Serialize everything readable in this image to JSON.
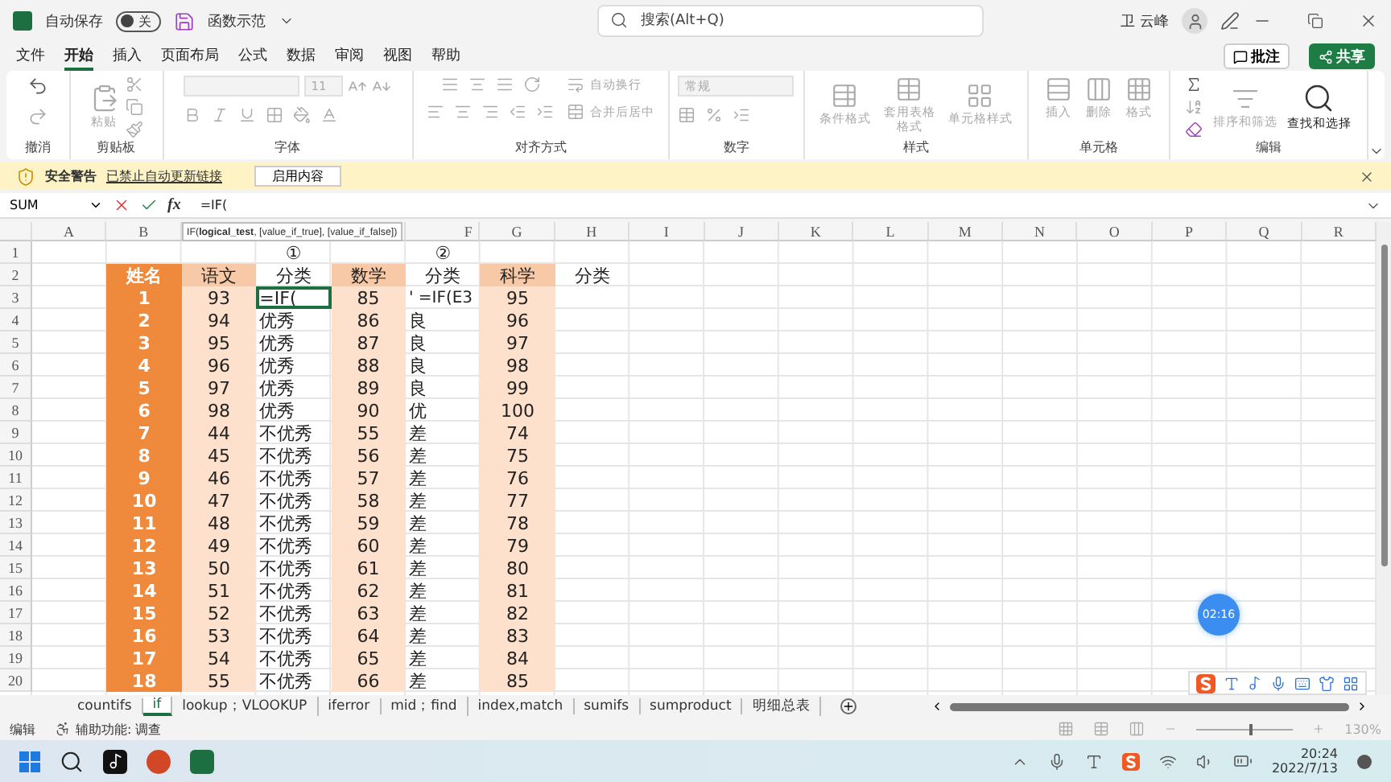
{
  "titlebar": {
    "autosave_label": "自动保存",
    "autosave": {
      "on": false,
      "label": "关"
    },
    "file_name": "函数示范",
    "search": {
      "placeholder": "搜索(Alt+Q)"
    },
    "user": "卫 云峰"
  },
  "menu": {
    "tabs": [
      {
        "label": "文件",
        "selected": false
      },
      {
        "label": "开始",
        "selected": true
      },
      {
        "label": "插入",
        "selected": false
      },
      {
        "label": "页面布局",
        "selected": false
      },
      {
        "label": "公式",
        "selected": false
      },
      {
        "label": "数据",
        "selected": false
      },
      {
        "label": "审阅",
        "selected": false
      },
      {
        "label": "视图",
        "selected": false
      },
      {
        "label": "帮助",
        "selected": false
      }
    ],
    "comment_button": "批注",
    "share_button": "共享"
  },
  "ribbon": {
    "groups": [
      {
        "kind": "undo",
        "label": "撤消"
      },
      {
        "kind": "clipboard",
        "label": "剪贴板",
        "buttons": [
          {
            "label": "粘贴",
            "disabled": true
          }
        ]
      },
      {
        "kind": "font",
        "label": "字体",
        "font_size": "11"
      },
      {
        "kind": "alignment",
        "label": "对齐方式",
        "buttons": [
          {
            "label": "自动换行",
            "disabled": true
          },
          {
            "label": "合并后居中",
            "disabled": true
          }
        ]
      },
      {
        "kind": "number",
        "label": "数字",
        "format": "常规"
      },
      {
        "kind": "styles",
        "label": "样式",
        "buttons": [
          {
            "label": "条件格式",
            "disabled": true
          },
          {
            "label": "套用表格格式",
            "disabled": true
          },
          {
            "label": "单元格样式",
            "disabled": true
          }
        ]
      },
      {
        "kind": "cells",
        "label": "单元格",
        "buttons": [
          {
            "label": "插入",
            "disabled": true
          },
          {
            "label": "删除",
            "disabled": true
          },
          {
            "label": "格式",
            "disabled": true
          }
        ]
      },
      {
        "kind": "editing",
        "label": "编辑",
        "buttons": [
          {
            "label": "排序和筛选",
            "disabled": true
          },
          {
            "label": "查找和选择",
            "disabled": false
          }
        ]
      }
    ]
  },
  "warning": {
    "title": "安全警告",
    "link": "已禁止自动更新链接",
    "button": "启用内容"
  },
  "formula_bar": {
    "name_box": "SUM",
    "function_label": "fx",
    "formula": "=IF("
  },
  "tooltip": "IF(**logical_test**, [value_if_true], [value_if_false])",
  "columns_left": [
    "A",
    "B"
  ],
  "columns_right": [
    "F",
    "G",
    "H",
    "I",
    "J",
    "K",
    "L",
    "M",
    "N",
    "O",
    "P",
    "Q",
    "R"
  ],
  "rows": [
    {
      "number": "1",
      "kind": "marker",
      "class1": "①",
      "class2": "②"
    },
    {
      "number": "2",
      "kind": "header",
      "name": "姓名",
      "chinese": "语文",
      "class1": "分类",
      "math": "数学",
      "class2": "分类",
      "science": "科学",
      "class3": "分类"
    },
    {
      "number": "3",
      "kind": "data",
      "editing": true,
      "name": "1",
      "chinese": "93",
      "class1": "=IF(",
      "math": "85",
      "class2": "'  =IF(E3",
      "science": "95"
    },
    {
      "number": "4",
      "kind": "data",
      "editing": false,
      "name": "2",
      "chinese": "94",
      "class1": "优秀",
      "math": "86",
      "class2": "良",
      "science": "96"
    },
    {
      "number": "5",
      "kind": "data",
      "editing": false,
      "name": "3",
      "chinese": "95",
      "class1": "优秀",
      "math": "87",
      "class2": "良",
      "science": "97"
    },
    {
      "number": "6",
      "kind": "data",
      "editing": false,
      "name": "4",
      "chinese": "96",
      "class1": "优秀",
      "math": "88",
      "class2": "良",
      "science": "98"
    },
    {
      "number": "7",
      "kind": "data",
      "editing": false,
      "name": "5",
      "chinese": "97",
      "class1": "优秀",
      "math": "89",
      "class2": "良",
      "science": "99"
    },
    {
      "number": "8",
      "kind": "data",
      "editing": false,
      "name": "6",
      "chinese": "98",
      "class1": "优秀",
      "math": "90",
      "class2": "优",
      "science": "100"
    },
    {
      "number": "9",
      "kind": "data",
      "editing": false,
      "name": "7",
      "chinese": "44",
      "class1": "不优秀",
      "math": "55",
      "class2": "差",
      "science": "74"
    },
    {
      "number": "10",
      "kind": "data",
      "editing": false,
      "name": "8",
      "chinese": "45",
      "class1": "不优秀",
      "math": "56",
      "class2": "差",
      "science": "75"
    },
    {
      "number": "11",
      "kind": "data",
      "editing": false,
      "name": "9",
      "chinese": "46",
      "class1": "不优秀",
      "math": "57",
      "class2": "差",
      "science": "76"
    },
    {
      "number": "12",
      "kind": "data",
      "editing": false,
      "name": "10",
      "chinese": "47",
      "class1": "不优秀",
      "math": "58",
      "class2": "差",
      "science": "77"
    },
    {
      "number": "13",
      "kind": "data",
      "editing": false,
      "name": "11",
      "chinese": "48",
      "class1": "不优秀",
      "math": "59",
      "class2": "差",
      "science": "78"
    },
    {
      "number": "14",
      "kind": "data",
      "editing": false,
      "name": "12",
      "chinese": "49",
      "class1": "不优秀",
      "math": "60",
      "class2": "差",
      "science": "79"
    },
    {
      "number": "15",
      "kind": "data",
      "editing": false,
      "name": "13",
      "chinese": "50",
      "class1": "不优秀",
      "math": "61",
      "class2": "差",
      "science": "80"
    },
    {
      "number": "16",
      "kind": "data",
      "editing": false,
      "name": "14",
      "chinese": "51",
      "class1": "不优秀",
      "math": "62",
      "class2": "差",
      "science": "81"
    },
    {
      "number": "17",
      "kind": "data",
      "editing": false,
      "name": "15",
      "chinese": "52",
      "class1": "不优秀",
      "math": "63",
      "class2": "差",
      "science": "82"
    },
    {
      "number": "18",
      "kind": "data",
      "editing": false,
      "name": "16",
      "chinese": "53",
      "class1": "不优秀",
      "math": "64",
      "class2": "差",
      "science": "83"
    },
    {
      "number": "19",
      "kind": "data",
      "editing": false,
      "name": "17",
      "chinese": "54",
      "class1": "不优秀",
      "math": "65",
      "class2": "差",
      "science": "84"
    },
    {
      "number": "20",
      "kind": "data",
      "editing": false,
      "name": "18",
      "chinese": "55",
      "class1": "不优秀",
      "math": "66",
      "class2": "差",
      "science": "85"
    }
  ],
  "timer": "02:16",
  "sheet_tabs": [
    {
      "label": "countifs",
      "selected": false
    },
    {
      "label": "if",
      "selected": true
    },
    {
      "label": "lookup；VLOOKUP",
      "selected": false
    },
    {
      "label": "iferror",
      "selected": false
    },
    {
      "label": "mid；find",
      "selected": false
    },
    {
      "label": "index,match",
      "selected": false
    },
    {
      "label": "sumifs",
      "selected": false
    },
    {
      "label": "sumproduct",
      "selected": false
    },
    {
      "label": "明细总表",
      "selected": false
    }
  ],
  "status_bar": {
    "mode": "编辑",
    "accessibility": "辅助功能: 调查",
    "zoom": {
      "reading": "130%",
      "level": 0.55
    }
  },
  "taskbar": {
    "time": "20:24",
    "date": "2022/7/13"
  }
}
